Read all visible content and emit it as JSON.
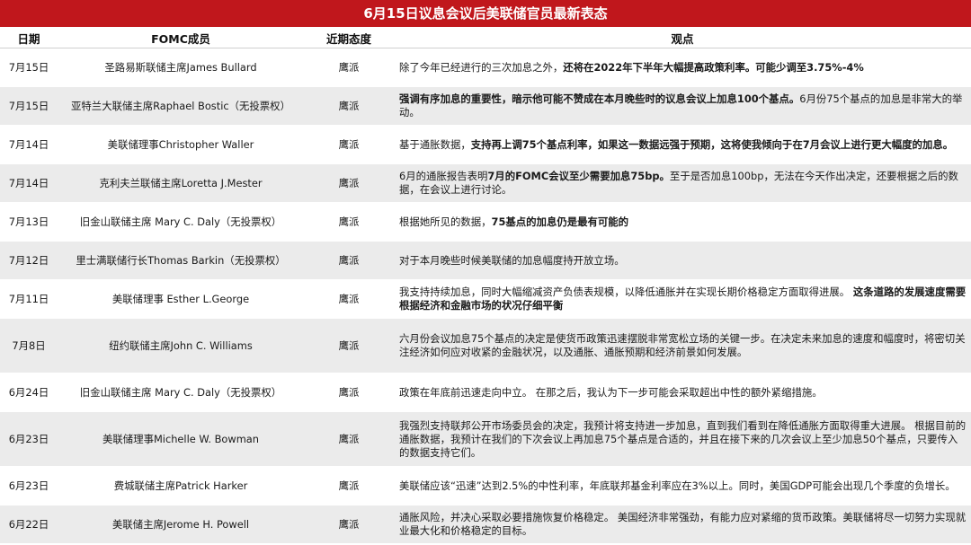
{
  "title": "6月15日议息会议后美联储官员最新表态",
  "headers": {
    "date": "日期",
    "member": "FOMC成员",
    "stance": "近期态度",
    "view": "观点"
  },
  "rows": [
    {
      "date": "7月15日",
      "member": "圣路易斯联储主席James Bullard",
      "stance": "鹰派",
      "view_segments": [
        {
          "text": "除了今年已经进行的三次加息之外，",
          "bold": false
        },
        {
          "text": "还将在2022年下半年大幅提高政策利率。可能少调至3.75%-4%",
          "bold": true
        }
      ]
    },
    {
      "date": "7月15日",
      "member": "亚特兰大联储主席Raphael Bostic（无投票权）",
      "stance": "鹰派",
      "view_segments": [
        {
          "text": "强调有序加息的重要性，暗示他可能不赞成在本月晚些时的议息会议上加息100个基点。",
          "bold": true
        },
        {
          "text": "6月份75个基点的加息是非常大的举动。",
          "bold": false
        }
      ]
    },
    {
      "date": "7月14日",
      "member": "美联储理事Christopher Waller",
      "stance": "鹰派",
      "view_segments": [
        {
          "text": "基于通胀数据，",
          "bold": false
        },
        {
          "text": "支持再上调75个基点利率，如果这一数据远强于预期，这将使我倾向于在7月会议上进行更大幅度的加息。",
          "bold": true
        }
      ]
    },
    {
      "date": "7月14日",
      "member": "克利夫兰联储主席Loretta J.Mester",
      "stance": "鹰派",
      "view_segments": [
        {
          "text": "6月的通胀报告表明",
          "bold": false
        },
        {
          "text": "7月的FOMC会议至少需要加息75bp。",
          "bold": true
        },
        {
          "text": "至于是否加息100bp，无法在今天作出决定，还要根据之后的数据，在会议上进行讨论。",
          "bold": false
        }
      ]
    },
    {
      "date": "7月13日",
      "member": "旧金山联储主席 Mary C. Daly（无投票权）",
      "stance": "鹰派",
      "view_segments": [
        {
          "text": "根据她所见的数据，",
          "bold": false
        },
        {
          "text": "75基点的加息仍是最有可能的",
          "bold": true
        }
      ]
    },
    {
      "date": "7月12日",
      "member": "里士满联储行长Thomas Barkin（无投票权）",
      "stance": "鹰派",
      "view_segments": [
        {
          "text": "对于本月晚些时候美联储的加息幅度持开放立场。",
          "bold": false
        }
      ]
    },
    {
      "date": "7月11日",
      "member": "美联储理事 Esther L.George",
      "stance": "鹰派",
      "view_segments": [
        {
          "text": "我支持持续加息，同时大幅缩减资产负债表规模，以降低通胀并在实现长期价格稳定方面取得进展。 ",
          "bold": false
        },
        {
          "text": "这条道路的发展速度需要根据经济和金融市场的状况仔细平衡",
          "bold": true
        }
      ]
    },
    {
      "date": "7月8日",
      "member": "纽约联储主席John C. Williams",
      "stance": "鹰派",
      "view_segments": [
        {
          "text": "六月份会议加息75个基点的决定是使货币政策迅速摆脱非常宽松立场的关键一步。在决定未来加息的速度和幅度时，将密切关注经济如何应对收紧的金融状况，以及通胀、通胀预期和经济前景如何发展。",
          "bold": false
        }
      ]
    },
    {
      "date": "6月24日",
      "member": "旧金山联储主席 Mary C. Daly（无投票权）",
      "stance": "鹰派",
      "view_segments": [
        {
          "text": "政策在年底前迅速走向中立。 在那之后，我认为下一步可能会采取超出中性的额外紧缩措施。",
          "bold": false
        }
      ]
    },
    {
      "date": "6月23日",
      "member": "美联储理事Michelle W. Bowman",
      "stance": "鹰派",
      "view_segments": [
        {
          "text": "我强烈支持联邦公开市场委员会的决定，我预计将支持进一步加息，直到我们看到在降低通胀方面取得重大进展。 根据目前的通胀数据，我预计在我们的下次会议上再加息75个基点是合适的，并且在接下来的几次会议上至少加息50个基点，只要传入的数据支持它们。",
          "bold": false
        }
      ]
    },
    {
      "date": "6月23日",
      "member": "费城联储主席Patrick Harker",
      "stance": "鹰派",
      "view_segments": [
        {
          "text": "美联储应该“迅速”达到2.5%的中性利率，年底联邦基金利率应在3%以上。同时，美国GDP可能会出现几个季度的负增长。",
          "bold": false
        }
      ]
    },
    {
      "date": "6月22日",
      "member": "美联储主席Jerome H. Powell",
      "stance": "鹰派",
      "view_segments": [
        {
          "text": "通胀风险，并决心采取必要措施恢复价格稳定。 美国经济非常强劲，有能力应对紧缩的货币政策。美联储将尽一切努力实现就业最大化和价格稳定的目标。",
          "bold": false
        }
      ]
    }
  ],
  "colors": {
    "title_bg": "#c0171c",
    "stripe": "#ebebeb"
  }
}
